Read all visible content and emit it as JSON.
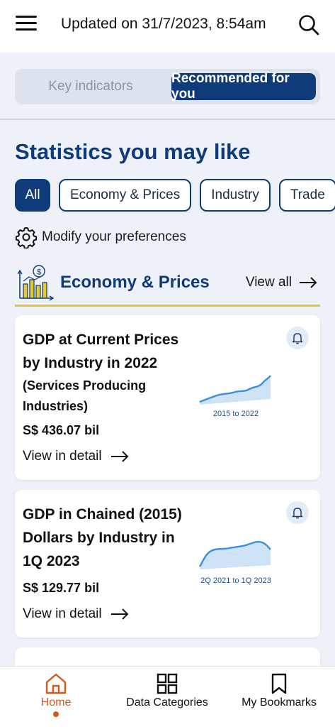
{
  "header": {
    "updated_text": "Updated on 31/7/2023, 8:54am",
    "menu_icon": "hamburger-menu-icon",
    "search_icon": "search-icon"
  },
  "segment": {
    "tab_key": "Key indicators",
    "tab_recommended": "Recommended for you",
    "active": "Recommended for you"
  },
  "main": {
    "title": "Statistics you may like",
    "chips": [
      "All",
      "Economy & Prices",
      "Industry",
      "Trade"
    ],
    "active_chip": "All",
    "preferences_label": "Modify your preferences"
  },
  "category": {
    "title": "Economy & Prices",
    "view_all": "View all",
    "icon": "economy-chart-dollar-icon"
  },
  "cards": [
    {
      "title": "GDP at Current Prices by Industry in 2022",
      "subtitle": "(Services Producing Industries)",
      "value": "S$ 436.07 bil",
      "detail": "View in detail",
      "period": "2015 to 2022",
      "icon": "bell-icon"
    },
    {
      "title": "GDP in Chained (2015) Dollars by Industry in 1Q 2023",
      "subtitle": "",
      "value": "S$ 129.77 bil",
      "detail": "View in detail",
      "period": "2Q 2021 to 1Q 2023",
      "icon": "bell-icon"
    }
  ],
  "bottom_nav": {
    "home": "Home",
    "categories": "Data Categories",
    "bookmarks": "My Bookmarks",
    "active": "Home"
  },
  "colors": {
    "primary": "#0f3b7a",
    "accent_orange": "#d4591c",
    "divider_yellow": "#d9c93a",
    "spark_line": "#3a8ee6"
  }
}
